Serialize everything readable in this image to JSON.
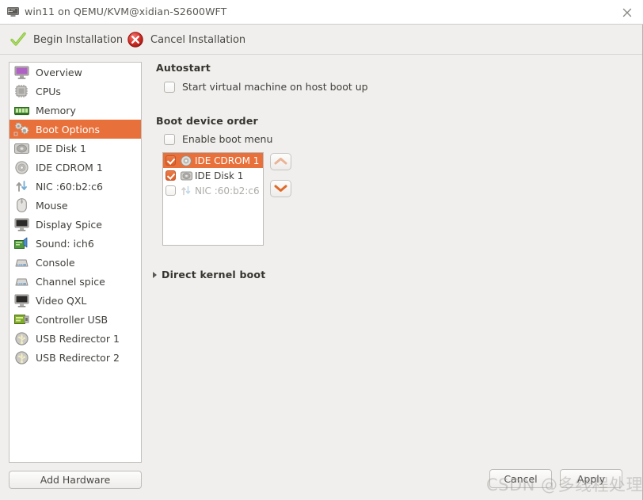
{
  "titlebar": {
    "icon": "computer-icon",
    "title": "win11 on QEMU/KVM@xidian-S2600WFT",
    "close_label": "close-icon"
  },
  "toolbar": {
    "begin_label": "Begin Installation",
    "begin_icon": "green-check-icon",
    "cancel_label": "Cancel Installation",
    "cancel_icon": "red-x-icon"
  },
  "sidebar": {
    "selected_index": 3,
    "items": [
      {
        "label": "Overview",
        "icon": "monitor-icon"
      },
      {
        "label": "CPUs",
        "icon": "cpu-chip-icon"
      },
      {
        "label": "Memory",
        "icon": "memory-ram-icon"
      },
      {
        "label": "Boot Options",
        "icon": "gears-icon"
      },
      {
        "label": "IDE Disk 1",
        "icon": "hard-disk-icon"
      },
      {
        "label": "IDE CDROM 1",
        "icon": "cdrom-disc-icon"
      },
      {
        "label": "NIC :60:b2:c6",
        "icon": "network-arrows-icon"
      },
      {
        "label": "Mouse",
        "icon": "mouse-icon"
      },
      {
        "label": "Display Spice",
        "icon": "display-icon"
      },
      {
        "label": "Sound: ich6",
        "icon": "sound-card-icon"
      },
      {
        "label": "Console",
        "icon": "console-icon"
      },
      {
        "label": "Channel spice",
        "icon": "console-icon"
      },
      {
        "label": "Video QXL",
        "icon": "display-icon"
      },
      {
        "label": "Controller USB",
        "icon": "usb-controller-icon"
      },
      {
        "label": "USB Redirector 1",
        "icon": "usb-redirector-icon"
      },
      {
        "label": "USB Redirector 2",
        "icon": "usb-redirector-icon"
      }
    ],
    "add_hardware_label": "Add Hardware"
  },
  "main": {
    "autostart": {
      "title": "Autostart",
      "checkbox_label": "Start virtual machine on host boot up",
      "checked": false
    },
    "boot_device_order": {
      "title": "Boot device order",
      "enable_boot_menu_label": "Enable boot menu",
      "enable_boot_menu_checked": false,
      "devices": [
        {
          "label": "IDE CDROM 1",
          "icon": "cdrom-disc-icon",
          "checked": true,
          "selected": true,
          "enabled": true
        },
        {
          "label": "IDE Disk 1",
          "icon": "hard-disk-icon",
          "checked": true,
          "selected": false,
          "enabled": true
        },
        {
          "label": "NIC :60:b2:c6",
          "icon": "network-arrows-icon",
          "checked": false,
          "selected": false,
          "enabled": false
        }
      ],
      "move_up_icon": "chevron-up-icon",
      "move_down_icon": "chevron-down-icon"
    },
    "direct_kernel_boot": {
      "label": "Direct kernel boot",
      "expanded": false,
      "icon": "triangle-right-icon"
    }
  },
  "footer": {
    "cancel_label": "Cancel",
    "apply_label": "Apply"
  },
  "watermark": {
    "text": "CSDN @多线程处理"
  },
  "colors": {
    "selection": "#e8703a",
    "window_bg": "#f0efed",
    "panel_bg": "#ffffff",
    "text": "#3c3b37"
  }
}
